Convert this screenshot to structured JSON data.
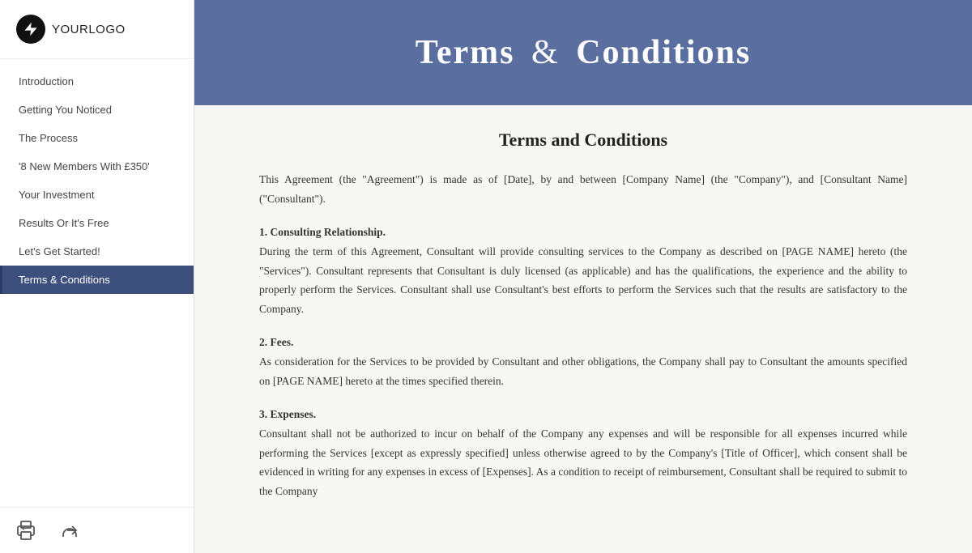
{
  "logo": {
    "text_bold": "YOUR",
    "text_light": "LOGO"
  },
  "nav": {
    "items": [
      {
        "label": "Introduction",
        "active": false
      },
      {
        "label": "Getting You Noticed",
        "active": false
      },
      {
        "label": "The Process",
        "active": false
      },
      {
        "label": "'8 New Members With £350'",
        "active": false
      },
      {
        "label": "Your Investment",
        "active": false
      },
      {
        "label": "Results Or It's Free",
        "active": false
      },
      {
        "label": "Let's Get Started!",
        "active": false
      },
      {
        "label": "Terms & Conditions",
        "active": true
      }
    ]
  },
  "actions": {
    "print_label": "Print",
    "share_label": "Share"
  },
  "header": {
    "title_part1": "Terms",
    "ampersand": "&",
    "title_part2": "Conditions"
  },
  "content": {
    "title": "Terms and Conditions",
    "intro": "This  Agreement  (the  \"Agreement\")  is  made  as  of  [Date],  by  and between  [Company  Name]  (the  \"Company\"),  and  [Consultant  Name] (\"Consultant\").",
    "section1_title": "1. Consulting Relationship.",
    "section1_body": "During  the  term  of  this  Agreement,  Consultant  will  provide  consulting services  to  the  Company  as  described  on  [PAGE NAME]  hereto  (the \"Services\").   Consultant  represents  that  Consultant  is  duly  licensed  (as applicable)  and  has  the  qualifications,  the  experience  and  the  ability  to properly perform the Services. Consultant shall use Consultant's best efforts to perform the Services such that the results are satisfactory to the Company.",
    "section2_title": "2. Fees.",
    "section2_body": "As  consideration  for  the  Services  to  be  provided  by  Consultant  and  other obligations,  the  Company  shall  pay  to  Consultant  the  amounts  specified  on [PAGE NAME] hereto at the times specified therein.",
    "section3_title": "3. Expenses.",
    "section3_body": "Consultant  shall  not  be  authorized  to  incur  on  behalf  of  the  Company  any expenses  and  will  be  responsible  for  all  expenses  incurred  while  performing the  Services  [except  as  expressly  specified]  unless  otherwise  agreed  to  by  the Company's  [Title  of  Officer],  which  consent  shall  be  evidenced  in  writing  for any  expenses  in  excess  of  [Expenses].  As  a  condition  to  receipt  of reimbursement,  Consultant  shall  be  required  to  submit  to  the  Company"
  }
}
